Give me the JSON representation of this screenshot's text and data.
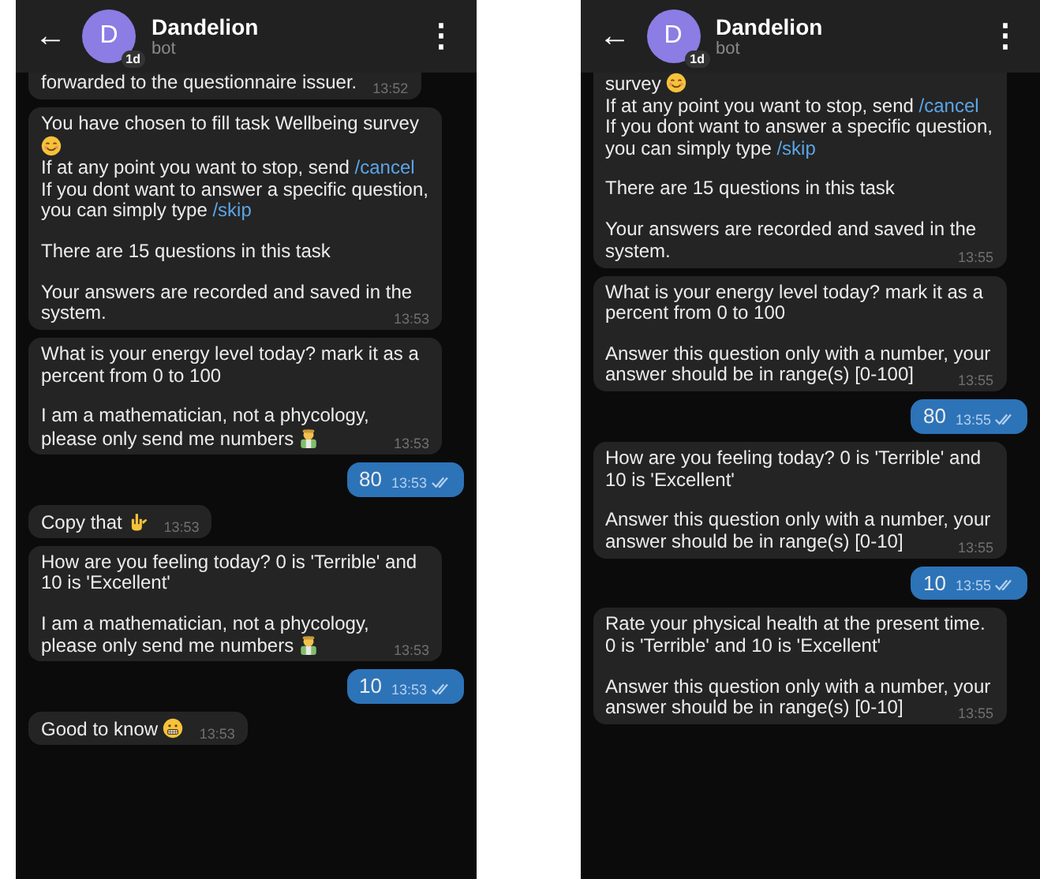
{
  "screens": [
    {
      "header": {
        "back": "←",
        "avatar_letter": "D",
        "avatar_badge": "1d",
        "title": "Dandelion",
        "subtitle": "bot",
        "menu": "⋮"
      },
      "messages": [
        {
          "kind": "incoming",
          "paragraphs": [
            [
              [
                {
                  "kind": "text",
                  "text": "forwarded to the questionnaire issuer."
                }
              ]
            ]
          ],
          "time": "13:52"
        },
        {
          "kind": "incoming",
          "paragraphs": [
            [
              [
                {
                  "kind": "text",
                  "text": "You have chosen to fill task Wellbeing survey "
                },
                {
                  "kind": "smile"
                }
              ],
              [
                {
                  "kind": "text",
                  "text": "If at any point you want to stop, send "
                },
                {
                  "kind": "command",
                  "text": "/cancel"
                }
              ],
              [
                {
                  "kind": "text",
                  "text": "If you dont want to answer a specific question, you can simply type "
                },
                {
                  "kind": "command",
                  "text": "/skip"
                }
              ]
            ],
            [
              [
                {
                  "kind": "text",
                  "text": "There are 15 questions in this task"
                }
              ]
            ],
            [
              [
                {
                  "kind": "text",
                  "text": "Your answers are recorded and saved in the system."
                }
              ]
            ]
          ],
          "time": "13:53"
        },
        {
          "kind": "incoming",
          "paragraphs": [
            [
              [
                {
                  "kind": "text",
                  "text": "What is your energy level today? mark it as a percent from 0 to 100"
                }
              ]
            ],
            [
              [
                {
                  "kind": "text",
                  "text": "I am a mathematician, not a phycology, please only send me numbers "
                },
                {
                  "kind": "scientist"
                }
              ]
            ]
          ],
          "time": "13:53"
        },
        {
          "kind": "outgoing",
          "paragraphs": [
            [
              [
                {
                  "kind": "text",
                  "text": "80"
                }
              ]
            ]
          ],
          "time": "13:53",
          "read": true
        },
        {
          "kind": "incoming",
          "paragraphs": [
            [
              [
                {
                  "kind": "text",
                  "text": "Copy that "
                },
                {
                  "kind": "hand"
                }
              ]
            ]
          ],
          "time": "13:53"
        },
        {
          "kind": "incoming",
          "paragraphs": [
            [
              [
                {
                  "kind": "text",
                  "text": "How are you feeling today? 0 is 'Terrible' and 10 is 'Excellent'"
                }
              ]
            ],
            [
              [
                {
                  "kind": "text",
                  "text": "I am a mathematician, not a phycology, please only send me numbers "
                },
                {
                  "kind": "scientist"
                }
              ]
            ]
          ],
          "time": "13:53"
        },
        {
          "kind": "outgoing",
          "paragraphs": [
            [
              [
                {
                  "kind": "text",
                  "text": "10"
                }
              ]
            ]
          ],
          "time": "13:53",
          "read": true
        },
        {
          "kind": "incoming",
          "paragraphs": [
            [
              [
                {
                  "kind": "text",
                  "text": "Good to know "
                },
                {
                  "kind": "grin"
                }
              ]
            ]
          ],
          "time": "13:53"
        }
      ]
    },
    {
      "header": {
        "back": "←",
        "avatar_letter": "D",
        "avatar_badge": "1d",
        "title": "Dandelion",
        "subtitle": "bot",
        "menu": "⋮"
      },
      "messages": [
        {
          "kind": "incoming",
          "paragraphs": [
            [
              [
                {
                  "kind": "text",
                  "text": "survey "
                },
                {
                  "kind": "smile"
                }
              ],
              [
                {
                  "kind": "text",
                  "text": "If at any point you want to stop, send "
                },
                {
                  "kind": "command",
                  "text": "/cancel"
                }
              ],
              [
                {
                  "kind": "text",
                  "text": "If you dont want to answer a specific question, you can simply type "
                },
                {
                  "kind": "command",
                  "text": "/skip"
                }
              ]
            ],
            [
              [
                {
                  "kind": "text",
                  "text": "There are 15 questions in this task"
                }
              ]
            ],
            [
              [
                {
                  "kind": "text",
                  "text": "Your answers are recorded and saved in the system."
                }
              ]
            ]
          ],
          "time": "13:55"
        },
        {
          "kind": "incoming",
          "paragraphs": [
            [
              [
                {
                  "kind": "text",
                  "text": "What is your energy level today? mark it as a percent from 0 to 100"
                }
              ]
            ],
            [
              [
                {
                  "kind": "text",
                  "text": "Answer this question only with a number, your answer should be in range(s) [0-100]"
                }
              ]
            ]
          ],
          "time": "13:55"
        },
        {
          "kind": "outgoing",
          "paragraphs": [
            [
              [
                {
                  "kind": "text",
                  "text": "80"
                }
              ]
            ]
          ],
          "time": "13:55",
          "read": true
        },
        {
          "kind": "incoming",
          "paragraphs": [
            [
              [
                {
                  "kind": "text",
                  "text": "How are you feeling today? 0 is 'Terrible' and 10 is 'Excellent'"
                }
              ]
            ],
            [
              [
                {
                  "kind": "text",
                  "text": "Answer this question only with a number, your answer should be in range(s) [0-10]"
                }
              ]
            ]
          ],
          "time": "13:55"
        },
        {
          "kind": "outgoing",
          "paragraphs": [
            [
              [
                {
                  "kind": "text",
                  "text": "10"
                }
              ]
            ]
          ],
          "time": "13:55",
          "read": true
        },
        {
          "kind": "incoming",
          "paragraphs": [
            [
              [
                {
                  "kind": "text",
                  "text": "Rate your physical health at the present time. 0 is 'Terrible' and 10 is 'Excellent'"
                }
              ]
            ],
            [
              [
                {
                  "kind": "text",
                  "text": "Answer this question only with a number, your answer should be in range(s) [0-10]"
                }
              ]
            ]
          ],
          "time": "13:55"
        }
      ]
    }
  ]
}
